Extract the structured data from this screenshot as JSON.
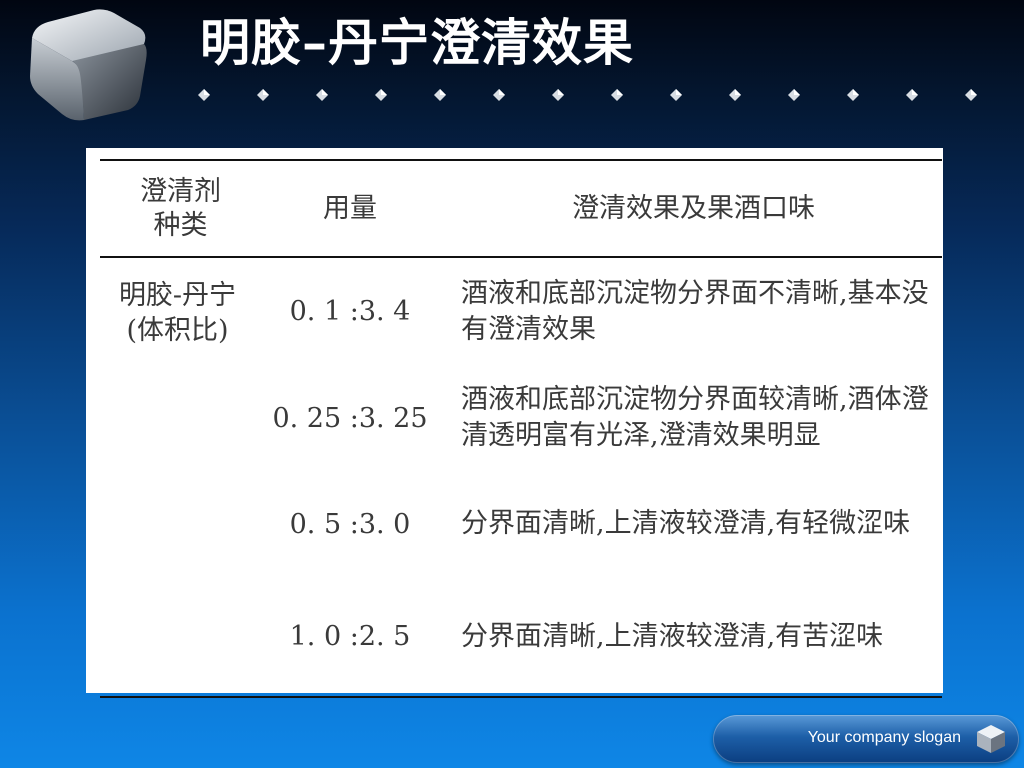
{
  "slide": {
    "title": "明胶–丹宁澄清效果"
  },
  "table": {
    "headers": {
      "type_line1": "澄清剂",
      "type_line2": "种类",
      "dose": "用量",
      "effect": "澄清效果及果酒口味"
    },
    "clarifier_type_line1": "明胶-丹宁",
    "clarifier_type_line2": "(体积比)",
    "rows": [
      {
        "dose": "0. 1  :3. 4",
        "effect": "酒液和底部沉淀物分界面不清晰,基本没有澄清效果"
      },
      {
        "dose": "0. 25  :3. 25",
        "effect": "酒液和底部沉淀物分界面较清晰,酒体澄清透明富有光泽,澄清效果明显"
      },
      {
        "dose": "0. 5  :3. 0",
        "effect": "分界面清晰,上清液较澄清,有轻微涩味"
      },
      {
        "dose": "1. 0  :2. 5",
        "effect": "分界面清晰,上清液较澄清,有苦涩味"
      }
    ]
  },
  "footer": {
    "slogan": "Your company slogan"
  },
  "icons": {
    "logo": "cube-icon",
    "bullet": "diamond-icon",
    "slogan": "small-cube-icon"
  },
  "colors": {
    "background_top": "#010611",
    "background_bottom": "#0e86e6",
    "title_text": "#ffffff",
    "table_text": "#3a3a3a"
  }
}
